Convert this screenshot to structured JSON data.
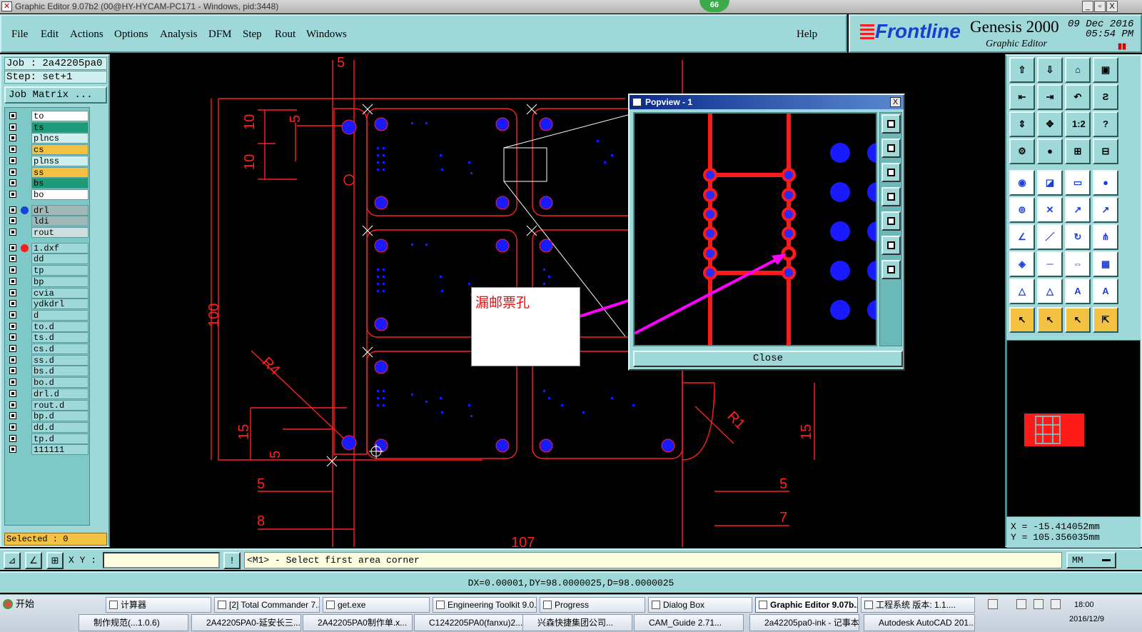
{
  "window": {
    "title": "Graphic Editor 9.07b2 (00@HY-HYCAM-PC171 - Windows, pid:3448)",
    "badge": "66",
    "controls": [
      "_",
      "▫",
      "X"
    ]
  },
  "menu": {
    "items": [
      "File",
      "Edit",
      "Actions",
      "Options",
      "Analysis",
      "DFM",
      "Step",
      "Rout",
      "Windows"
    ],
    "help": "Help"
  },
  "brand": {
    "logo": "Frontline",
    "product": "Genesis 2000",
    "subtitle": "Graphic Editor",
    "date": "09 Dec 2016",
    "time": "05:54 PM"
  },
  "left": {
    "job": "Job : 2a42205pa0",
    "step": "Step: set+1",
    "job_matrix": "Job Matrix ...",
    "layers": [
      {
        "name": "to",
        "color": "#ffffff",
        "dot": ""
      },
      {
        "name": "ts",
        "color": "#1e9a78",
        "dot": ""
      },
      {
        "name": "plncs",
        "color": "#cfeeee",
        "dot": ""
      },
      {
        "name": "cs",
        "color": "#f4c242",
        "dot": ""
      },
      {
        "name": "plnss",
        "color": "#cfeeee",
        "dot": ""
      },
      {
        "name": "ss",
        "color": "#f4c242",
        "dot": ""
      },
      {
        "name": "bs",
        "color": "#1e9a78",
        "dot": ""
      },
      {
        "name": "bo",
        "color": "#ffffff",
        "dot": ""
      },
      {
        "name": "drl",
        "color": "#a0b8b8",
        "dot": "#1a3fe0"
      },
      {
        "name": "ldi",
        "color": "#a0b8b8",
        "dot": ""
      },
      {
        "name": "rout",
        "color": "#cfdede",
        "dot": ""
      },
      {
        "name": "1.dxf",
        "color": "#9ed8d8",
        "dot": "#ff1a1a"
      },
      {
        "name": "dd",
        "color": "#9ed8d8",
        "dot": ""
      },
      {
        "name": "tp",
        "color": "#9ed8d8",
        "dot": ""
      },
      {
        "name": "bp",
        "color": "#9ed8d8",
        "dot": ""
      },
      {
        "name": "cvia",
        "color": "#9ed8d8",
        "dot": ""
      },
      {
        "name": "ydkdrl",
        "color": "#9ed8d8",
        "dot": ""
      },
      {
        "name": "d",
        "color": "#9ed8d8",
        "dot": ""
      },
      {
        "name": "to.d",
        "color": "#9ed8d8",
        "dot": ""
      },
      {
        "name": "ts.d",
        "color": "#9ed8d8",
        "dot": ""
      },
      {
        "name": "cs.d",
        "color": "#9ed8d8",
        "dot": ""
      },
      {
        "name": "ss.d",
        "color": "#9ed8d8",
        "dot": ""
      },
      {
        "name": "bs.d",
        "color": "#9ed8d8",
        "dot": ""
      },
      {
        "name": "bo.d",
        "color": "#9ed8d8",
        "dot": ""
      },
      {
        "name": "drl.d",
        "color": "#9ed8d8",
        "dot": ""
      },
      {
        "name": "rout.d",
        "color": "#9ed8d8",
        "dot": ""
      },
      {
        "name": "bp.d",
        "color": "#9ed8d8",
        "dot": ""
      },
      {
        "name": "dd.d",
        "color": "#9ed8d8",
        "dot": ""
      },
      {
        "name": "tp.d",
        "color": "#9ed8d8",
        "dot": ""
      },
      {
        "name": "111111",
        "color": "#9ed8d8",
        "dot": ""
      }
    ],
    "selected": "Selected : 0"
  },
  "canvas": {
    "dim_labels": [
      "5",
      "10",
      "10",
      "5",
      "100",
      "R4",
      "15",
      "5",
      "5",
      "8",
      "107",
      "5",
      "7",
      "15",
      "R1"
    ],
    "colors": {
      "outline": "#ff2020",
      "pad": "#1a1aff",
      "line": "#ffffff"
    }
  },
  "popview": {
    "title": "Popview - 1",
    "close_label": "Close",
    "close_x": "X"
  },
  "annotation": {
    "text": "漏邮票孔",
    "arrow_color": "#ff00ff"
  },
  "coords": {
    "x": "X = -15.414052mm",
    "y": "Y = 105.356035mm"
  },
  "command": {
    "xy_label": "X Y :",
    "xy_value": "",
    "message": "<M1> - Select first area corner",
    "units": "MM"
  },
  "status": {
    "text": "DX=0.00001,DY=98.0000025,D=98.0000025"
  },
  "taskbar": {
    "start": "开始",
    "tasks": [
      {
        "label": "计算器",
        "active": false
      },
      {
        "label": "[2] Total Commander 7....",
        "active": false
      },
      {
        "label": "get.exe",
        "active": false
      },
      {
        "label": "Engineering Toolkit 9.0...",
        "active": false
      },
      {
        "label": "Progress",
        "active": false
      },
      {
        "label": "Dialog Box",
        "active": false
      },
      {
        "label": "Graphic Editor 9.07b...",
        "active": true
      },
      {
        "label": "工程系统  版本: 1.1....",
        "active": false
      }
    ],
    "row2": [
      "制作规范(...1.0.6)",
      "2A42205PA0-延安长三...",
      "2A42205PA0制作单.x...",
      "C1242205PA0(fanxu)2...",
      "兴森快捷集团公司...",
      "CAM_Guide 2.71...",
      "2a42205pa0-ink - 记事本",
      "Autodesk AutoCAD 201..."
    ],
    "clock_time": "18:00",
    "clock_date": "2016/12/9"
  }
}
